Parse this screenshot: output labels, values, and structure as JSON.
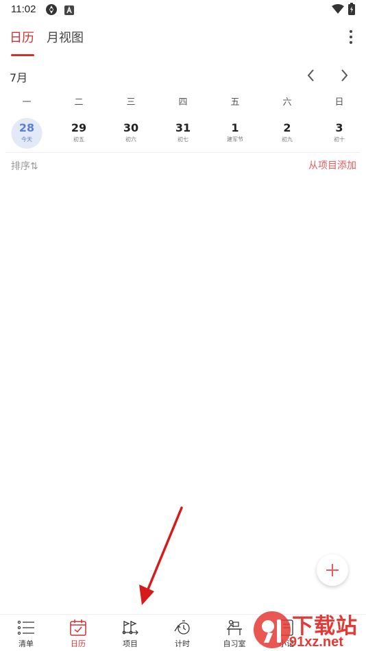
{
  "status_bar": {
    "time": "11:02"
  },
  "header": {
    "tab_active": "日历",
    "tab_inactive": "月视图"
  },
  "month": {
    "label": "7月"
  },
  "weekdays": [
    "一",
    "二",
    "三",
    "四",
    "五",
    "六",
    "日"
  ],
  "days": [
    {
      "num": "28",
      "sub": "今天",
      "today": true
    },
    {
      "num": "29",
      "sub": "初五"
    },
    {
      "num": "30",
      "sub": "初六"
    },
    {
      "num": "31",
      "sub": "初七"
    },
    {
      "num": "1",
      "sub": "建军节"
    },
    {
      "num": "2",
      "sub": "初九"
    },
    {
      "num": "3",
      "sub": "初十"
    }
  ],
  "sort": {
    "label": "排序⇅"
  },
  "add_from_project": "从项目添加",
  "bottom_nav": [
    {
      "label": "清单",
      "icon": "list-icon"
    },
    {
      "label": "日历",
      "icon": "calendar-icon",
      "active": true
    },
    {
      "label": "项目",
      "icon": "project-flag-icon"
    },
    {
      "label": "计时",
      "icon": "timer-icon"
    },
    {
      "label": "自习室",
      "icon": "study-room-icon"
    },
    {
      "label": "小记",
      "icon": "notes-icon"
    }
  ],
  "watermark": {
    "title": "下载站",
    "url": "91xz.net"
  },
  "colors": {
    "accent": "#d32f2f",
    "today": "#5b7fd6",
    "today_bg": "#e4e9f8",
    "link": "#e85b5b"
  }
}
